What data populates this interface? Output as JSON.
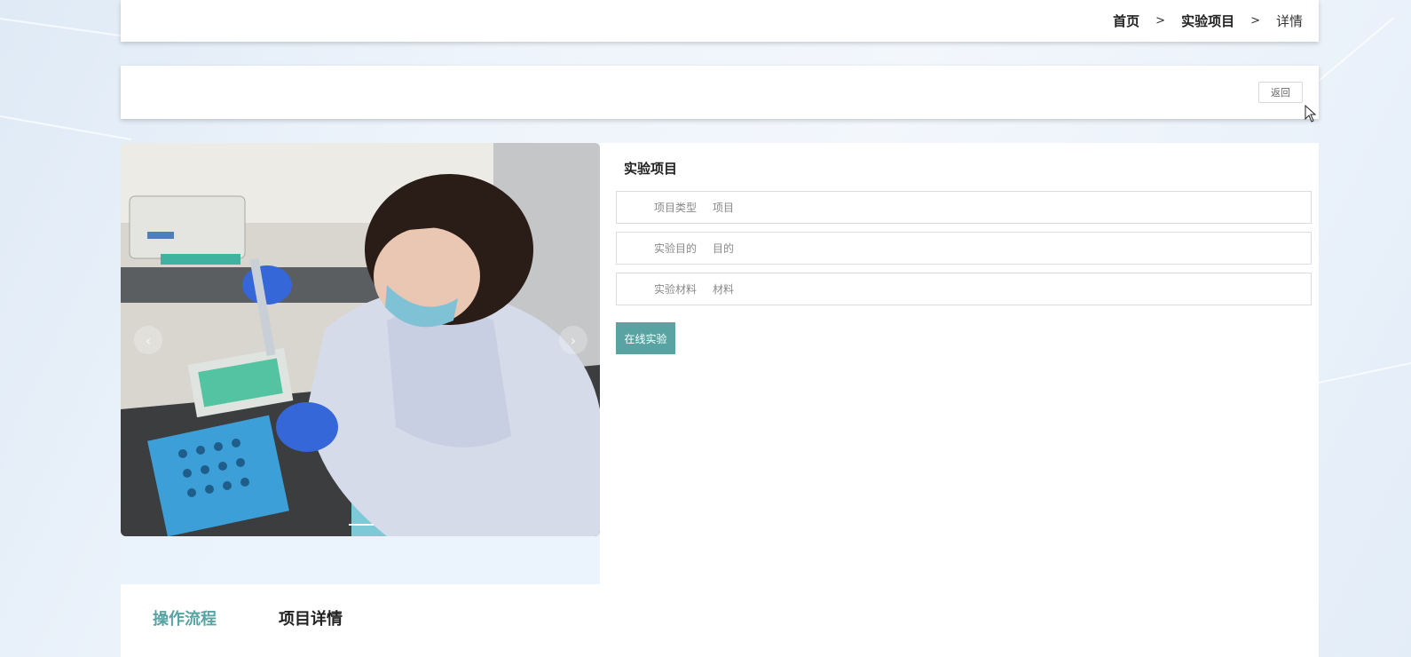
{
  "breadcrumb": {
    "home": "首页",
    "section": "实验项目",
    "current": "详情",
    "separator": ">"
  },
  "actions": {
    "back_label": "返回"
  },
  "carousel": {
    "prev_arrow": "‹",
    "next_arrow": "›",
    "image_icon": "lab-photo"
  },
  "detail": {
    "title": "实验项目",
    "rows": [
      {
        "label": "项目类型",
        "value": "项目"
      },
      {
        "label": "实验目的",
        "value": "目的"
      },
      {
        "label": "实验材料",
        "value": "材料"
      }
    ],
    "online_button": "在线实验"
  },
  "tabs": [
    {
      "label": "操作流程"
    },
    {
      "label": "项目详情"
    }
  ],
  "colors": {
    "accent": "#5aa3a3",
    "text_dark": "#222222",
    "text_muted": "#888888"
  }
}
